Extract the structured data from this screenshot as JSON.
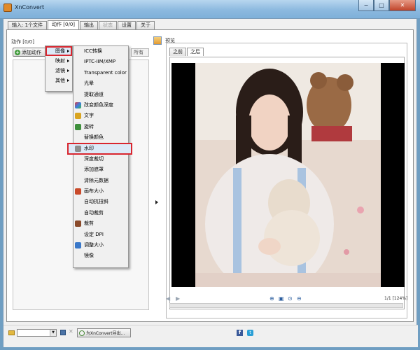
{
  "window": {
    "title": "XnConvert"
  },
  "tabs": [
    {
      "label": "输入: 1个文件",
      "state": "normal"
    },
    {
      "label": "动作 [0/0]",
      "state": "active"
    },
    {
      "label": "输出",
      "state": "normal"
    },
    {
      "label": "状态",
      "state": "disabled"
    },
    {
      "label": "设置",
      "state": "normal"
    },
    {
      "label": "关于",
      "state": "normal"
    }
  ],
  "actions_panel": {
    "label": "动作 [0/0]",
    "add_action": "添加动作",
    "clear_all": "所有"
  },
  "context_menu": {
    "categories": [
      {
        "label": "图像",
        "highlighted": true
      },
      {
        "label": "映射",
        "highlighted": false
      },
      {
        "label": "滤镜",
        "highlighted": false
      },
      {
        "label": "其他",
        "highlighted": false
      }
    ],
    "image_actions": [
      {
        "label": "ICC转换",
        "icon": "",
        "highlighted": false
      },
      {
        "label": "IPTC-IIM/XMP",
        "icon": "",
        "highlighted": false
      },
      {
        "label": "Transparent color",
        "icon": "",
        "highlighted": false
      },
      {
        "label": "光晕",
        "icon": "",
        "highlighted": false
      },
      {
        "label": "提取通道",
        "icon": "",
        "highlighted": false
      },
      {
        "label": "改变颜色深度",
        "icon": "color-depth-icon",
        "highlighted": false
      },
      {
        "label": "文字",
        "icon": "text-icon",
        "highlighted": false
      },
      {
        "label": "旋转",
        "icon": "rotate-icon",
        "highlighted": false
      },
      {
        "label": "替换颜色",
        "icon": "",
        "highlighted": false
      },
      {
        "label": "水印",
        "icon": "watermark-icon",
        "highlighted": true
      },
      {
        "label": "深度裁切",
        "icon": "",
        "highlighted": false
      },
      {
        "label": "添加遮罩",
        "icon": "",
        "highlighted": false
      },
      {
        "label": "清除元数据",
        "icon": "",
        "highlighted": false
      },
      {
        "label": "画布大小",
        "icon": "canvas-size-icon",
        "highlighted": false
      },
      {
        "label": "自动抗扭斜",
        "icon": "",
        "highlighted": false
      },
      {
        "label": "自动裁剪",
        "icon": "",
        "highlighted": false
      },
      {
        "label": "裁剪",
        "icon": "crop-icon",
        "highlighted": false
      },
      {
        "label": "设定 DPI",
        "icon": "",
        "highlighted": false
      },
      {
        "label": "调整大小",
        "icon": "resize-icon",
        "highlighted": false
      },
      {
        "label": "镜像",
        "icon": "",
        "highlighted": false
      }
    ]
  },
  "preview": {
    "label": "预览",
    "tabs": [
      "之前",
      "之后"
    ],
    "active_tab": "之后",
    "zoom_readout": "1/1 [124%]"
  },
  "bottom_bar": {
    "export_label": "为XnConvert导出..."
  },
  "colors": {
    "highlight_border": "#d9262f",
    "photo_background": "#000000"
  }
}
